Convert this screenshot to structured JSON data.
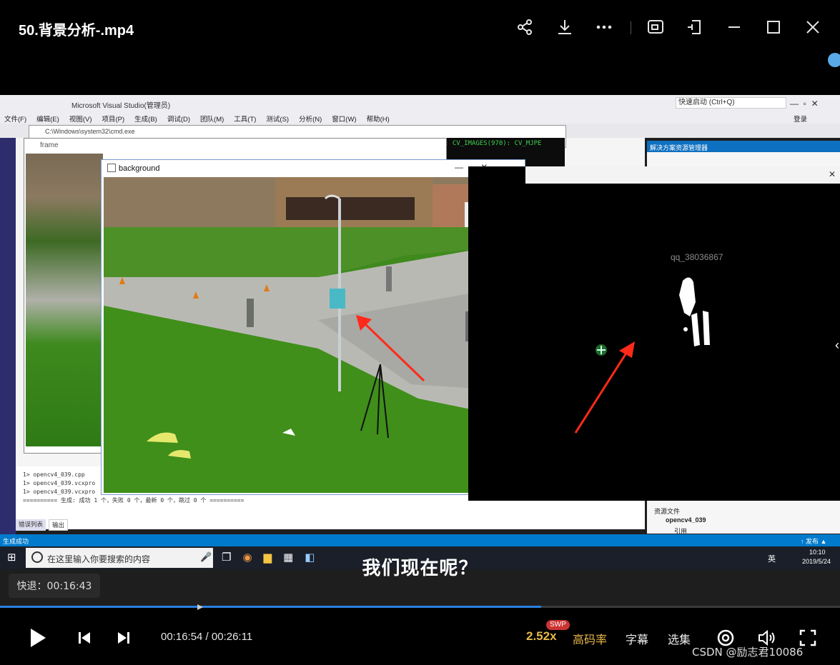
{
  "window": {
    "title": "50.背景分析-.mp4"
  },
  "top_icons": [
    "share-icon",
    "download-icon",
    "more-icon",
    "pip-icon",
    "pin-icon",
    "minimize-icon",
    "maximize-icon",
    "close-icon"
  ],
  "video": {
    "vs_title": "Microsoft Visual Studio(管理员)",
    "vs_menu": [
      "文件(F)",
      "编辑(E)",
      "视图(V)",
      "项目(P)",
      "生成(B)",
      "调试(D)",
      "团队(M)",
      "工具(T)",
      "测试(S)",
      "分析(N)",
      "窗口(W)",
      "帮助(H)"
    ],
    "vs_quick_launch": "快速启动 (Ctrl+Q)",
    "vs_login": "登录",
    "cmd_title": "C:\\Windows\\system32\\cmd.exe",
    "cmd_text": ": CV_IMAGES(970): CV_MJPE",
    "frame_title": "frame",
    "background_title": "background",
    "solution_header": "解决方案资源管理器",
    "solution_items": [
      "资源文件",
      "opencv4_039",
      "引用"
    ],
    "output_lines": [
      "1>  opencv4_039.cpp",
      "1>  opencv4_039.vcxpro",
      "1>  opencv4_039.vcxpro",
      "========== 生成: 成功 1 个，失败 0 个，最新 0 个，跳过 0 个 =========="
    ],
    "output_tabs": [
      "错误列表",
      "输出"
    ],
    "status_left": "生成成功",
    "status_right": "↑ 发布 ▲",
    "taskbar_search": "在这里输入你要搜索的内容",
    "taskbar_ime": "英",
    "taskbar_time": "10:10",
    "taskbar_date": "2019/5/24",
    "mask_watermark": "qq_38036867"
  },
  "subtitle": "我们现在呢？",
  "rewind_toast": "快退：00:16:43",
  "progress": {
    "played_fraction": 0.644
  },
  "controls": {
    "time": "00:16:54 / 00:26:11",
    "speed": "2.52x",
    "swp_badge": "SWP",
    "quality": "高码率",
    "subtitles": "字幕",
    "episodes": "选集",
    "credit": "CSDN @励志君10086"
  },
  "colors": {
    "accent_progress": "#2b7fe0",
    "speed_gold": "#e8b84a",
    "arrow_red": "#ff2a1a"
  }
}
